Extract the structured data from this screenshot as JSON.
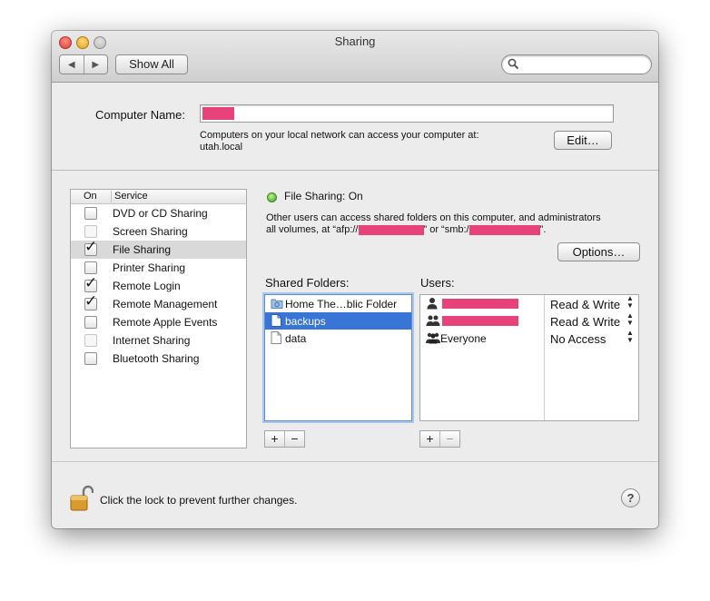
{
  "window": {
    "title": "Sharing"
  },
  "toolbar": {
    "back_label": "◀",
    "forward_label": "▶",
    "show_all_label": "Show All",
    "search_placeholder": ""
  },
  "computer_name": {
    "label": "Computer Name:",
    "value": "",
    "description_line1": "Computers on your local network can access your computer at:",
    "description_line2": "utah.local",
    "edit_label": "Edit…"
  },
  "services": {
    "header_on": "On",
    "header_service": "Service",
    "items": [
      {
        "name": "DVD or CD Sharing",
        "checked": false,
        "enabled": true,
        "selected": false
      },
      {
        "name": "Screen Sharing",
        "checked": false,
        "enabled": false,
        "selected": false
      },
      {
        "name": "File Sharing",
        "checked": true,
        "enabled": true,
        "selected": true
      },
      {
        "name": "Printer Sharing",
        "checked": false,
        "enabled": true,
        "selected": false
      },
      {
        "name": "Remote Login",
        "checked": true,
        "enabled": true,
        "selected": false
      },
      {
        "name": "Remote Management",
        "checked": true,
        "enabled": true,
        "selected": false
      },
      {
        "name": "Remote Apple Events",
        "checked": false,
        "enabled": true,
        "selected": false
      },
      {
        "name": "Internet Sharing",
        "checked": false,
        "enabled": false,
        "selected": false
      },
      {
        "name": "Bluetooth Sharing",
        "checked": false,
        "enabled": true,
        "selected": false
      }
    ]
  },
  "detail": {
    "status": "File Sharing: On",
    "status_color": "#3aa01c",
    "description_line1": "Other users can access shared folders on this computer, and administrators",
    "description_part1": "all volumes, at “afp://",
    "description_part2": "” or “smb:/",
    "description_part3": "”.",
    "options_label": "Options…",
    "shared_folders_label": "Shared Folders:",
    "users_label": "Users:",
    "folders": [
      {
        "name": "Home The…blic Folder",
        "icon": "public-folder-icon",
        "selected": false
      },
      {
        "name": "backups",
        "icon": "document-icon",
        "selected": true
      },
      {
        "name": "data",
        "icon": "document-icon",
        "selected": false
      }
    ],
    "users": [
      {
        "name": "",
        "icon": "single-user-icon",
        "permission": "Read & Write",
        "redacted": true
      },
      {
        "name": "",
        "icon": "group-icon",
        "permission": "Read & Write",
        "redacted": true
      },
      {
        "name": "Everyone",
        "icon": "everyone-icon",
        "permission": "No Access",
        "redacted": false
      }
    ],
    "add_label": "+",
    "remove_label": "−"
  },
  "footer": {
    "lock_text": "Click the lock to prevent further changes.",
    "help_label": "?"
  },
  "colors": {
    "selection": "#3875d7",
    "redaction": "#e8427a"
  }
}
